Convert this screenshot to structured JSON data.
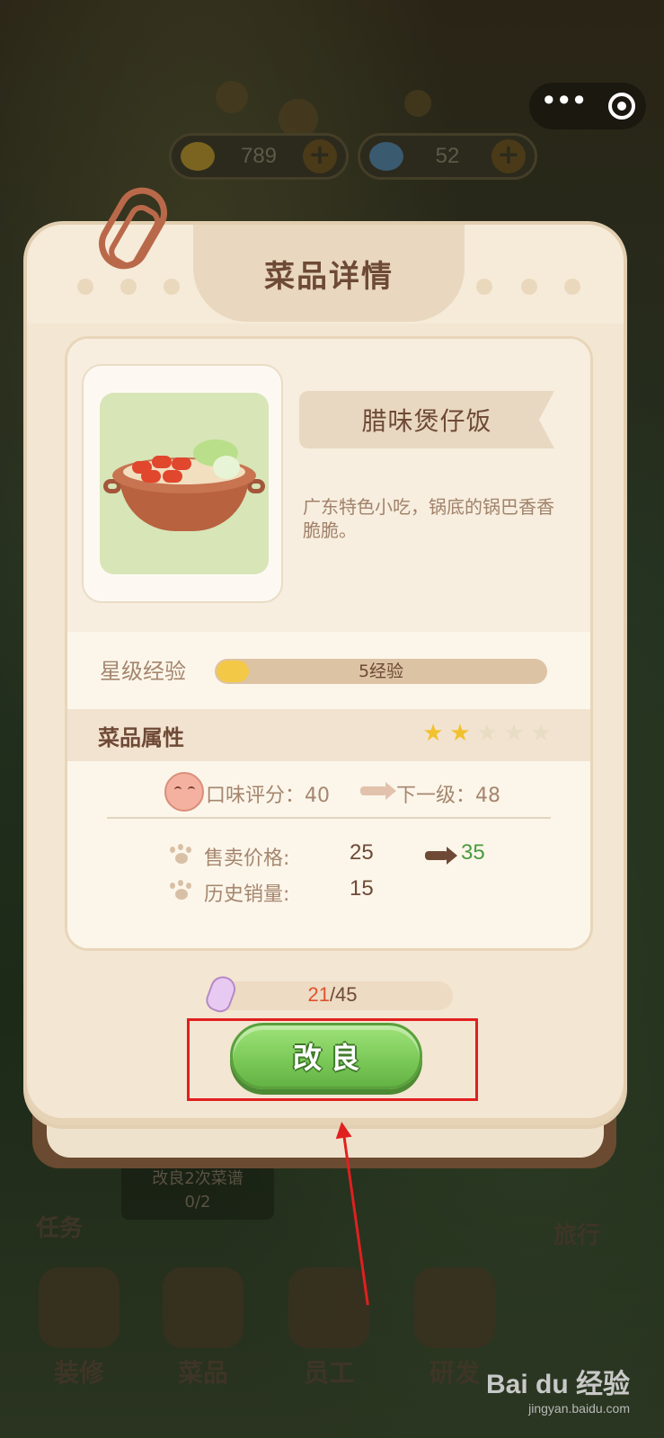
{
  "resources": {
    "coins": "789",
    "gems": "52"
  },
  "modal": {
    "title": "菜品详情",
    "dish_name": "腊味煲仔饭",
    "description": "广东特色小吃，锅底的锅巴香香脆脆。",
    "star_exp_label": "星级经验",
    "exp_text": "5经验",
    "exp_fraction": 0.09,
    "attributes_label": "菜品属性",
    "stars_filled": 2,
    "stars_total": 5,
    "taste_label": "口味评分：40",
    "next_level_label": "下一级：48",
    "price_label": "售卖价格:",
    "price_value": "25",
    "price_next": "35",
    "sales_label": "历史销量:",
    "sales_value": "15",
    "ingredient_current": "21",
    "ingredient_total": "/45",
    "improve_button": "改良"
  },
  "background": {
    "task_label": "任务",
    "task_text": "改良2次菜谱",
    "task_progress": "0/2",
    "travel_label": "旅行",
    "nav": [
      "装修",
      "菜品",
      "员工",
      "研发"
    ]
  },
  "watermark": {
    "brand": "Bai du 经验",
    "url": "jingyan.baidu.com"
  },
  "colors": {
    "accent_green": "#79c857",
    "highlight_red": "#e02020",
    "title_brown": "#6e4a36"
  }
}
